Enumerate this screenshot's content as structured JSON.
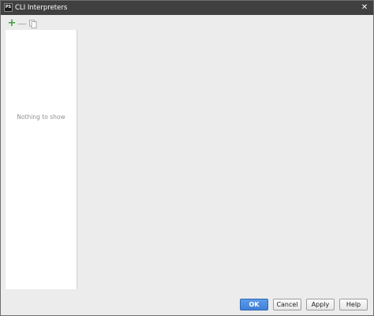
{
  "window": {
    "title": "CLI Interpreters",
    "app_icon_text": "PS",
    "close_glyph": "✕"
  },
  "toolbar": {
    "add_glyph": "+",
    "remove_glyph": "—",
    "icons": [
      "plus-icon",
      "minus-icon",
      "copy-icon"
    ]
  },
  "list": {
    "empty_text": "Nothing to show"
  },
  "buttons": {
    "ok": "OK",
    "cancel": "Cancel",
    "apply": "Apply",
    "help": "Help"
  },
  "colors": {
    "titlebar": "#404040",
    "add_icon": "#3c9b39",
    "ok_button": "#4a8bdf",
    "background": "#ececec"
  }
}
